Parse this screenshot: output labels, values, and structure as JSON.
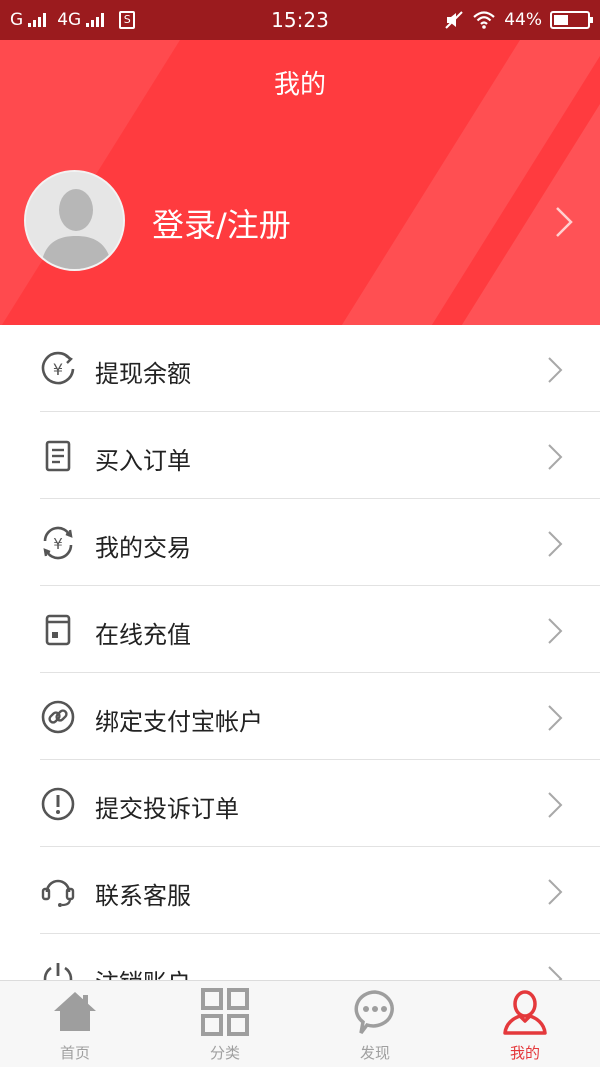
{
  "status_bar": {
    "carrier1": "G",
    "carrier2": "4G",
    "sim_badge": "S",
    "time": "15:23",
    "battery_text": "44%",
    "battery_level": 0.44,
    "icons": [
      "signal-icon",
      "sim-icon",
      "mute-icon",
      "wifi-icon",
      "battery-icon"
    ]
  },
  "header": {
    "title": "我的",
    "login_label": "登录/注册",
    "colors": {
      "background": "#ff3b3f",
      "status_bar": "#9b1b1e"
    }
  },
  "menu": [
    {
      "label": "提现余额",
      "icon": "withdraw-yuan-icon"
    },
    {
      "label": "买入订单",
      "icon": "order-document-icon"
    },
    {
      "label": "我的交易",
      "icon": "exchange-yuan-icon"
    },
    {
      "label": "在线充值",
      "icon": "recharge-card-icon"
    },
    {
      "label": "绑定支付宝帐户",
      "icon": "link-icon"
    },
    {
      "label": "提交投诉订单",
      "icon": "exclamation-icon"
    },
    {
      "label": "联系客服",
      "icon": "headset-icon"
    },
    {
      "label": "注销账户",
      "icon": "power-icon"
    }
  ],
  "tabbar": {
    "active_color": "#e4393c",
    "inactive_color": "#a0a0a0",
    "tabs": [
      {
        "label": "首页",
        "icon": "home-icon",
        "active": false
      },
      {
        "label": "分类",
        "icon": "grid-icon",
        "active": false
      },
      {
        "label": "发现",
        "icon": "chat-bubble-icon",
        "active": false
      },
      {
        "label": "我的",
        "icon": "user-icon",
        "active": true
      }
    ]
  }
}
